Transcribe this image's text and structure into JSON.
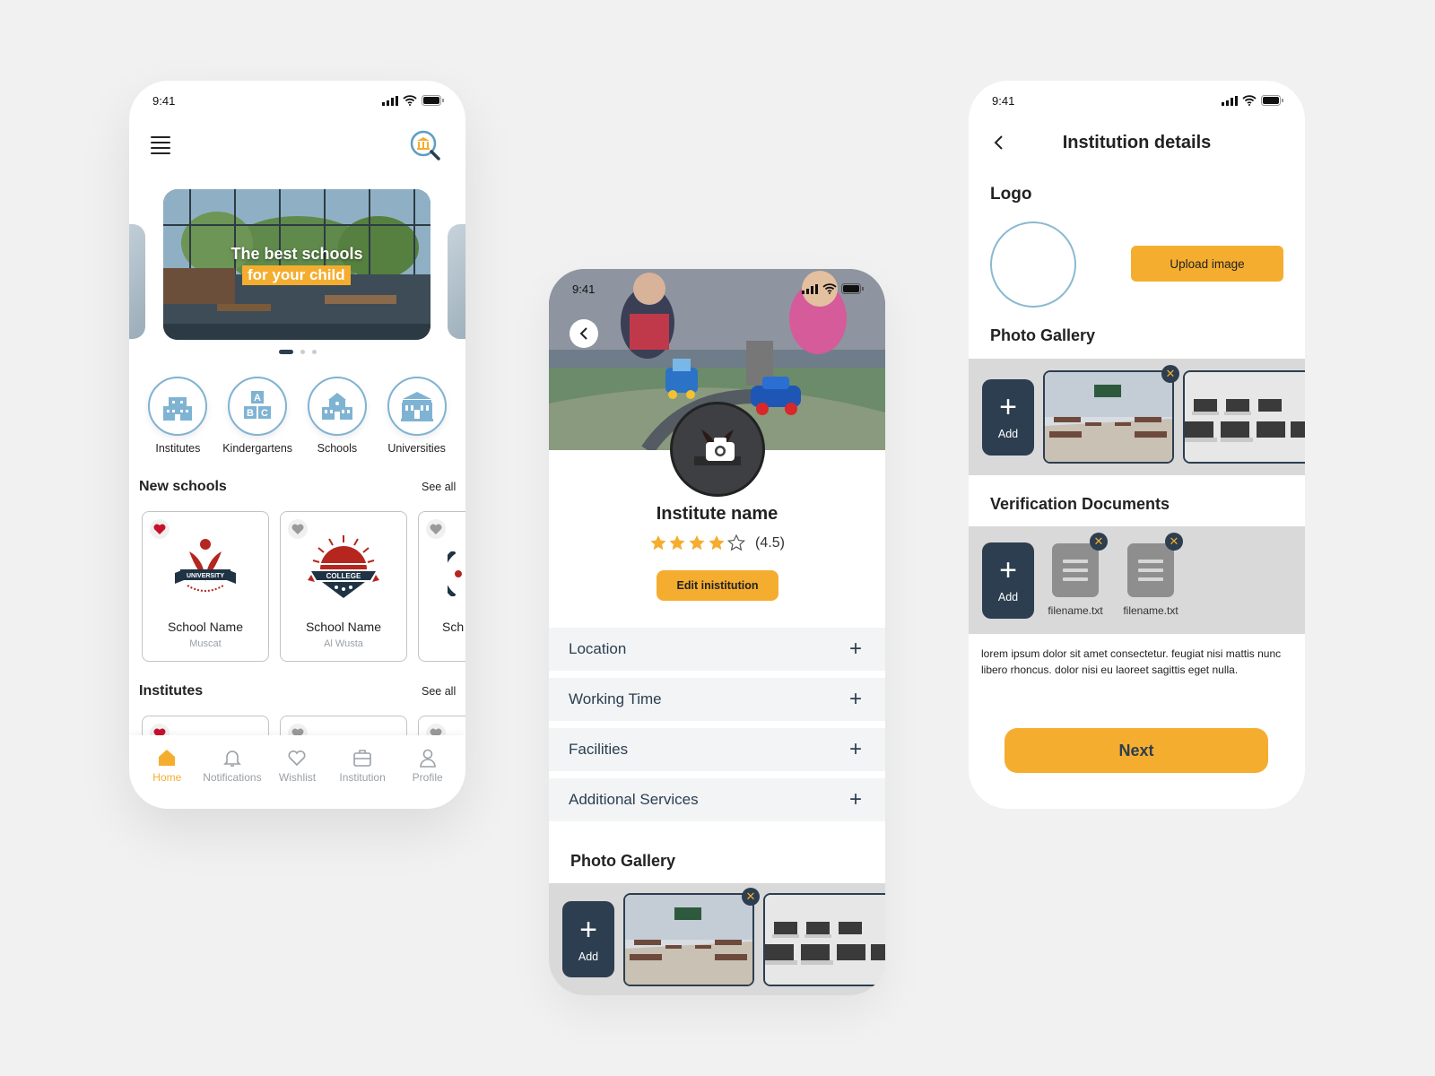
{
  "status": {
    "time": "9:41"
  },
  "home": {
    "banner": {
      "line1": "The best schools",
      "line2": "for your child"
    },
    "categories": [
      {
        "label": "Institutes",
        "icon": "building-icon"
      },
      {
        "label": "Kindergartens",
        "icon": "abc-blocks-icon"
      },
      {
        "label": "Schools",
        "icon": "school-icon"
      },
      {
        "label": "Universities",
        "icon": "university-icon"
      }
    ],
    "new_schools": {
      "title": "New schools",
      "see_all": "See all"
    },
    "schools": [
      {
        "name": "School Name",
        "location": "Muscat",
        "favorite": true,
        "logo_text": "UNIVERSITY"
      },
      {
        "name": "School Name",
        "location": "Al Wusta",
        "favorite": false,
        "logo_text": "COLLEGE"
      },
      {
        "name": "Sch",
        "location": "",
        "favorite": false,
        "logo_text": ""
      }
    ],
    "institutes": {
      "title": "Institutes",
      "see_all": "See all"
    },
    "tabs": [
      {
        "label": "Home",
        "icon": "home-icon",
        "active": true
      },
      {
        "label": "Notifications",
        "icon": "bell-icon",
        "active": false
      },
      {
        "label": "Wishlist",
        "icon": "heart-icon",
        "active": false
      },
      {
        "label": "Institution",
        "icon": "briefcase-icon",
        "active": false
      },
      {
        "label": "Profile",
        "icon": "user-icon",
        "active": false
      }
    ]
  },
  "profile": {
    "name": "Institute name",
    "rating": "(4.5)",
    "rating_value": 4.5,
    "edit_label": "Edit inistitution",
    "sections": [
      "Location",
      "Working Time",
      "Facilities",
      "Additional Services"
    ],
    "gallery_title": "Photo Gallery",
    "add_label": "Add"
  },
  "details": {
    "title": "Institution details",
    "logo_title": "Logo",
    "upload_label": "Upload image",
    "gallery_title": "Photo Gallery",
    "add_label": "Add",
    "verification_title": "Verification Documents",
    "files": [
      "filename.txt",
      "filename.txt"
    ],
    "description": "lorem ipsum dolor sit amet consectetur. feugiat nisi mattis nunc libero rhoncus. dolor nisi eu laoreet sagittis eget nulla.",
    "next_label": "Next"
  },
  "colors": {
    "accent": "#f5ad2f",
    "navy": "#2c3e50",
    "light_blue": "#7fb3d3",
    "heart_red": "#c8102e"
  }
}
